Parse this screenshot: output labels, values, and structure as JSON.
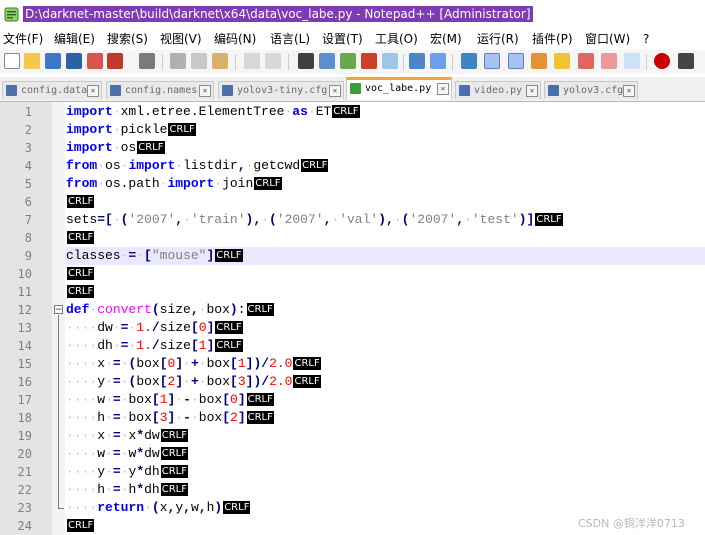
{
  "window": {
    "title": "D:\\darknet-master\\build\\darknet\\x64\\data\\voc_labe.py - Notepad++ [Administrator]",
    "title_highlight_color": "#7e3cb4"
  },
  "menu": [
    "文件(F)",
    "编辑(E)",
    "搜索(S)",
    "视图(V)",
    "编码(N)",
    "语言(L)",
    "设置(T)",
    "工具(O)",
    "宏(M)",
    "运行(R)",
    "插件(P)",
    "窗口(W)",
    "?"
  ],
  "toolbar_icons": [
    "new-file-icon",
    "open-file-icon",
    "save-icon",
    "save-all-icon",
    "close-icon",
    "close-all-icon",
    "print-icon",
    "cut-icon",
    "copy-icon",
    "paste-icon",
    "undo-icon",
    "redo-icon",
    "find-icon",
    "replace-icon",
    "zoom-in-icon",
    "zoom-out-icon",
    "sync-vertical-icon",
    "sync-horizontal-icon",
    "word-wrap-icon",
    "show-all-characters-icon",
    "indent-guide-icon",
    "doc-map-icon",
    "function-list-icon",
    "folder-workspace-icon",
    "doc-switcher-icon",
    "monitoring-icon",
    "record-macro-icon",
    "stop-macro-icon"
  ],
  "tabs": [
    {
      "label": "config.data",
      "active": false
    },
    {
      "label": "config.names",
      "active": false
    },
    {
      "label": "yolov3-tiny.cfg",
      "active": false
    },
    {
      "label": "voc_labe.py",
      "active": true
    },
    {
      "label": "video.py",
      "active": false
    },
    {
      "label": "yolov3.cfg",
      "active": false
    }
  ],
  "editor": {
    "current_line": 9,
    "eol_marker": "CRLF",
    "lines": [
      "import xml.etree.ElementTree as ET",
      "import pickle",
      "import os",
      "from os import listdir, getcwd",
      "from os.path import join",
      "",
      "sets=[ ('2007', 'train'), ('2007', 'val'), ('2007', 'test')]",
      "",
      "classes = [\"mouse\"]",
      "",
      "",
      "def convert(size, box):",
      "    dw = 1./size[0]",
      "    dh = 1./size[1]",
      "    x = (box[0] + box[1])/2.0",
      "    y = (box[2] + box[3])/2.0",
      "    w = box[1] - box[0]",
      "    h = box[3] - box[2]",
      "    x = x*dw",
      "    w = w*dw",
      "    y = y*dh",
      "    h = h*dh",
      "    return (x,y,w,h)",
      ""
    ]
  },
  "watermark": "CSDN @铜洋洋0713"
}
